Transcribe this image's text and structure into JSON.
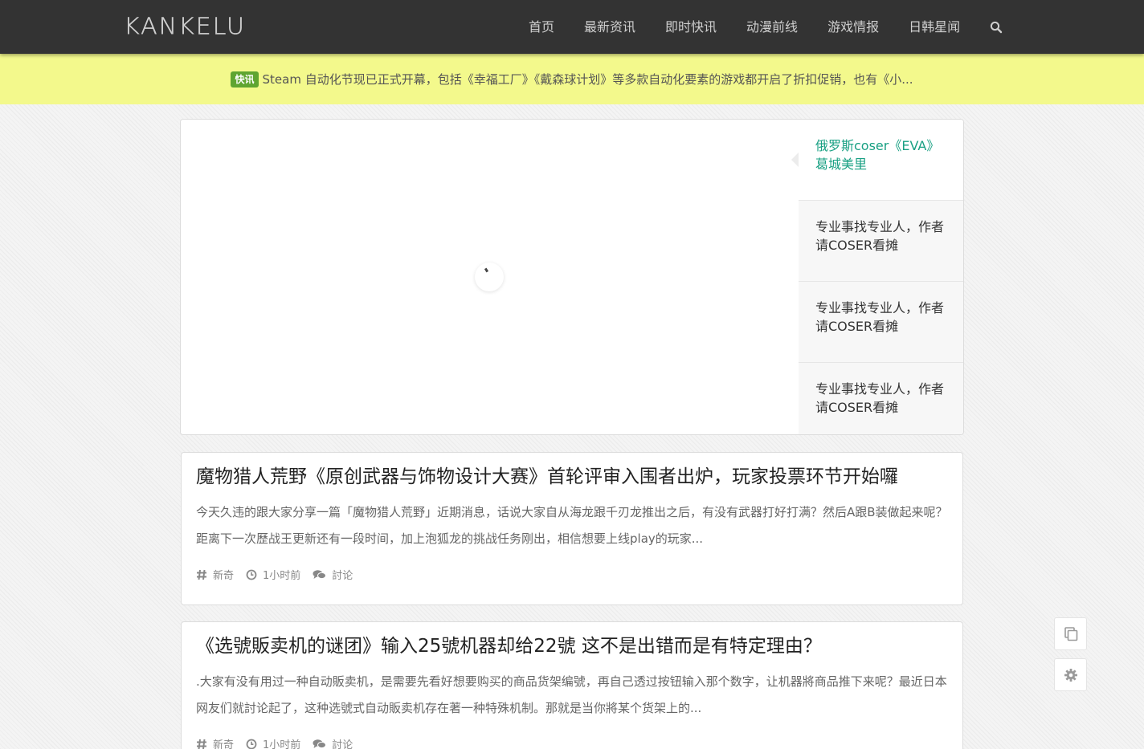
{
  "header": {
    "logo": "KANKELU",
    "nav": [
      "首页",
      "最新资讯",
      "即时快讯",
      "动漫前线",
      "游戏情报",
      "日韩星闻"
    ],
    "search_icon": "search-icon"
  },
  "ticker": {
    "badge": "快讯",
    "text": "Steam 自动化节现已正式开幕，包括《幸福工厂》《戴森球计划》等多款自动化要素的游戏都开启了折扣促销，也有《小..."
  },
  "slider": {
    "items": [
      {
        "title": "俄罗斯coser《EVA》葛城美里",
        "active": true
      },
      {
        "title": "专业事找专业人，作者请COSER看摊",
        "active": false
      },
      {
        "title": "专业事找专业人，作者请COSER看摊",
        "active": false
      },
      {
        "title": "专业事找专业人，作者请COSER看摊",
        "active": false
      }
    ]
  },
  "articles": [
    {
      "title": "魔物猎人荒野《原创武器与饰物设计大赛》首轮评审入围者出炉，玩家投票环节开始囉",
      "excerpt": "今天久违的跟大家分享一篇「魔物猎人荒野」近期消息，话说大家自从海龙跟千刃龙推出之后，有没有武器打好打满？然后A跟B装做起来呢？距离下一次歷战王更新还有一段时间，加上泡狐龙的挑战任务刚出，相信想要上线play的玩家...",
      "category": "新奇",
      "time": "1小时前",
      "comments": "討论"
    },
    {
      "title": "《选號販卖机的谜团》输入25號机器却给22號 这不是出错而是有特定理由？",
      "excerpt": ".大家有没有用过一种自动販卖机，是需要先看好想要购买的商品货架编號，再自己透过按钮输入那个数字，让机器將商品推下来呢？最近日本网友们就討论起了，这种选號式自动販卖机存在著一种特殊机制。那就是当你將某个货架上的...",
      "category": "新奇",
      "time": "1小时前",
      "comments": "討论"
    }
  ],
  "float_buttons": [
    "copy-icon",
    "gear-icon"
  ],
  "colors": {
    "header_bg": "#333333",
    "ticker_bg": "#f3f98c",
    "badge_bg": "#5fa531",
    "active_slide": "#19a083"
  }
}
